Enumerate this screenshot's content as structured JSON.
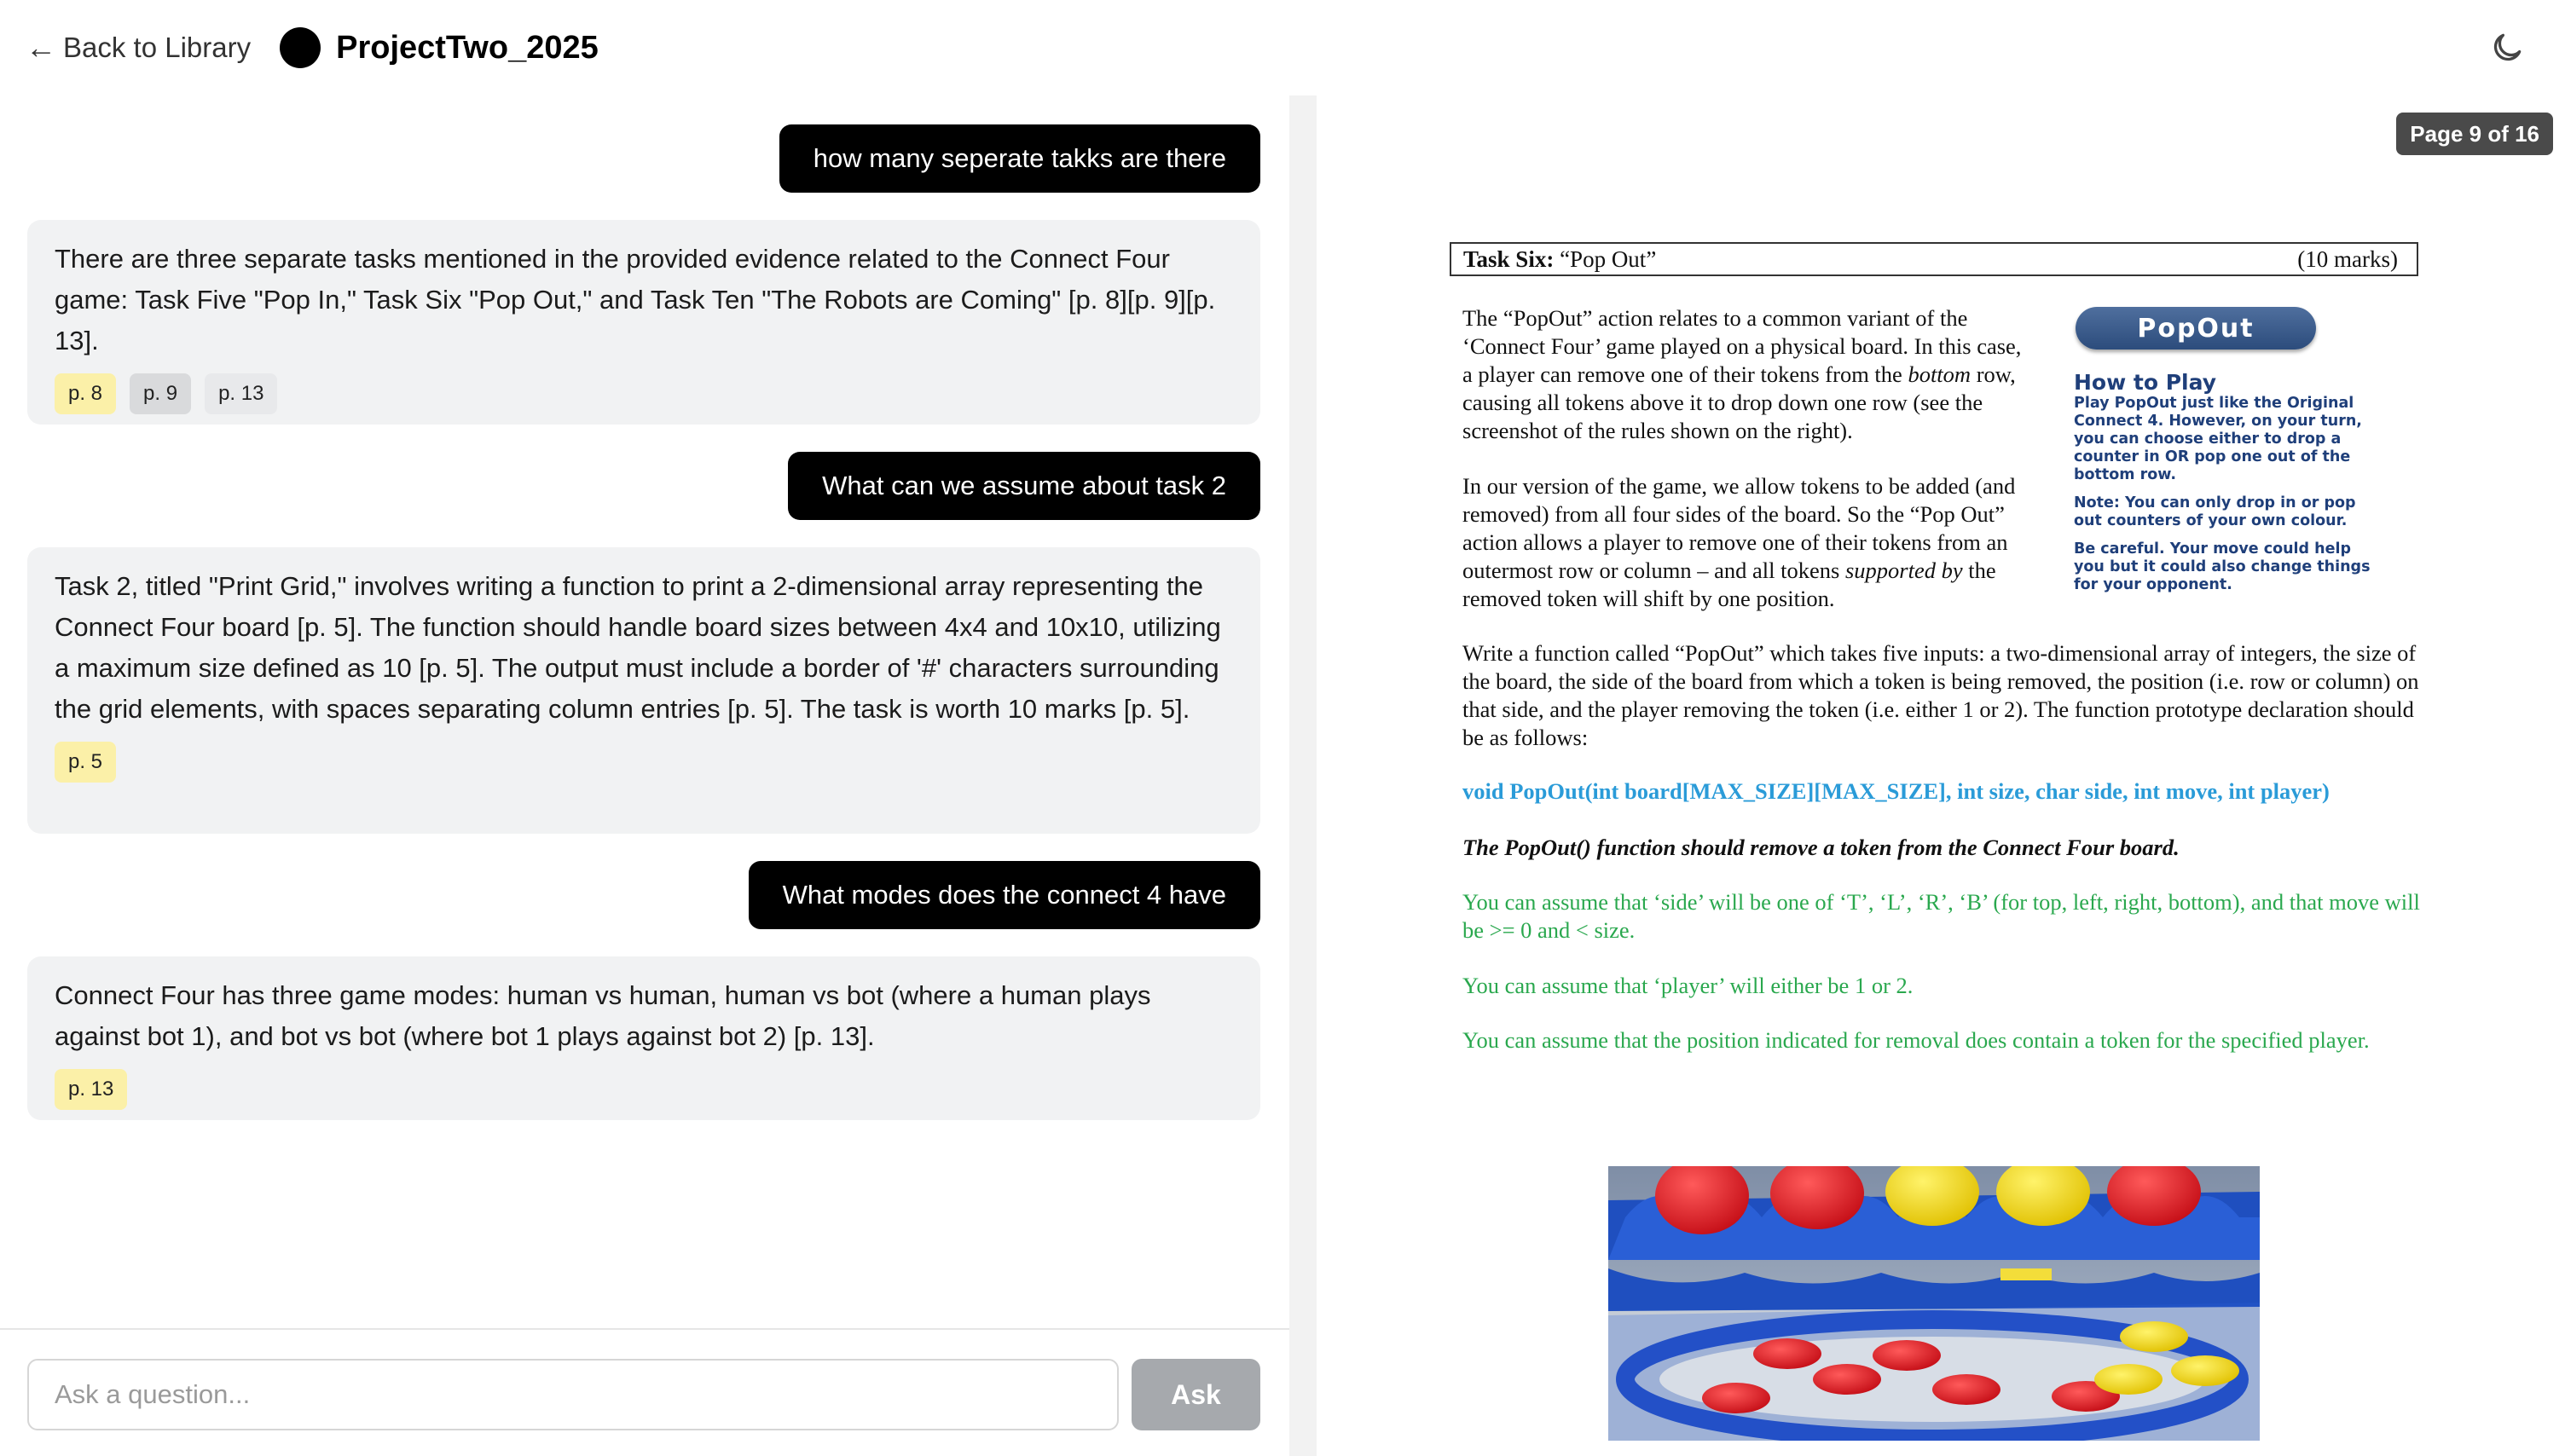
{
  "header": {
    "back_label": "Back to Library",
    "project_title": "ProjectTwo_2025"
  },
  "chat": {
    "messages": [
      {
        "role": "user",
        "text": "how many seperate takks are there"
      },
      {
        "role": "assistant",
        "text": "There are three separate tasks mentioned in the provided evidence related to the Connect Four game: Task Five \"Pop In,\" Task Six \"Pop Out,\" and Task Ten \"The Robots are Coming\" [p. 8][p. 9][p. 13].",
        "citations": [
          "p. 8",
          "p. 9",
          "p. 13"
        ]
      },
      {
        "role": "user",
        "text": "What can we assume about task 2"
      },
      {
        "role": "assistant",
        "text": "Task 2, titled \"Print Grid,\" involves writing a function to print a 2-dimensional array representing the Connect Four board [p. 5]. The function should handle board sizes between 4x4 and 10x10, utilizing a maximum size defined as 10 [p. 5]. The output must include a border of '#' characters surrounding the grid elements, with spaces separating column entries [p. 5]. The task is worth 10 marks [p. 5].",
        "citations": [
          "p. 5"
        ]
      },
      {
        "role": "user",
        "text": "What modes does the connect 4 have"
      },
      {
        "role": "assistant",
        "text": "Connect Four has three game modes: human vs human, human vs bot (where a human plays against bot 1), and bot vs bot (where bot 1 plays against bot 2) [p. 13].",
        "citations": [
          "p. 13"
        ]
      }
    ]
  },
  "input": {
    "placeholder": "Ask a question...",
    "ask_label": "Ask"
  },
  "viewer": {
    "page_indicator": "Page 9 of 16",
    "task_title_bold": "Task Six:",
    "task_title_rest": "“Pop Out”",
    "task_marks": "(10 marks)",
    "para1_a": "The “PopOut” action relates to a common variant of the ‘Connect Four’ game played on a physical board.  In this case, a player can remove one of their tokens from the ",
    "para1_em": "bottom",
    "para1_b": " row, causing all tokens above it to drop down one row (see the screenshot of the rules shown on the right).",
    "para2_a": "In our version of the game, we allow tokens to be added (and removed) from all four sides of the board.  So the “Pop Out” action allows a player to remove one of their tokens from an outermost row or column – and all tokens ",
    "para2_em": "supported by",
    "para2_b": " the removed token will shift by one position.",
    "para3": "Write a function called “PopOut” which takes five inputs: a two-dimensional array of integers, the size of the board, the side of the board from which a token is being removed, the position (i.e. row or column) on that side, and the player removing the token (i.e. either 1 or 2).  The function prototype declaration should be as follows:",
    "prototype": "void PopOut(int board[MAX_SIZE][MAX_SIZE], int size, char side, int move, int player)",
    "statement": "The PopOut() function should remove a token from the Connect Four board.",
    "assume1": "You can assume that ‘side’ will be one of ‘T’, ‘L’, ‘R’, ‘B’ (for top, left, right, bottom), and that move will be >= 0 and < size.",
    "assume2": "You can assume that ‘player’ will either be 1 or 2.",
    "assume3": "You can assume that the position indicated for removal does contain a token for the specified player.",
    "rules_box": {
      "logo": "PopOut",
      "heading": "How to Play",
      "text1": "Play PopOut just like the Original Connect 4. However, on your turn, you can choose either to drop a counter in OR pop one out of the bottom row.",
      "text2": "Note: You can only drop in or pop out counters of your own colour.",
      "text3": "Be careful. Your move could help you but it could also change things for your opponent."
    }
  },
  "colors": {
    "user_bubble": "#000000",
    "assistant_bubble": "#f1f2f3",
    "citation_highlight": "#fbf0a8",
    "ask_button": "#a6a9ad",
    "doc_green": "#2aa84e",
    "doc_blue": "#2a9bd8"
  }
}
